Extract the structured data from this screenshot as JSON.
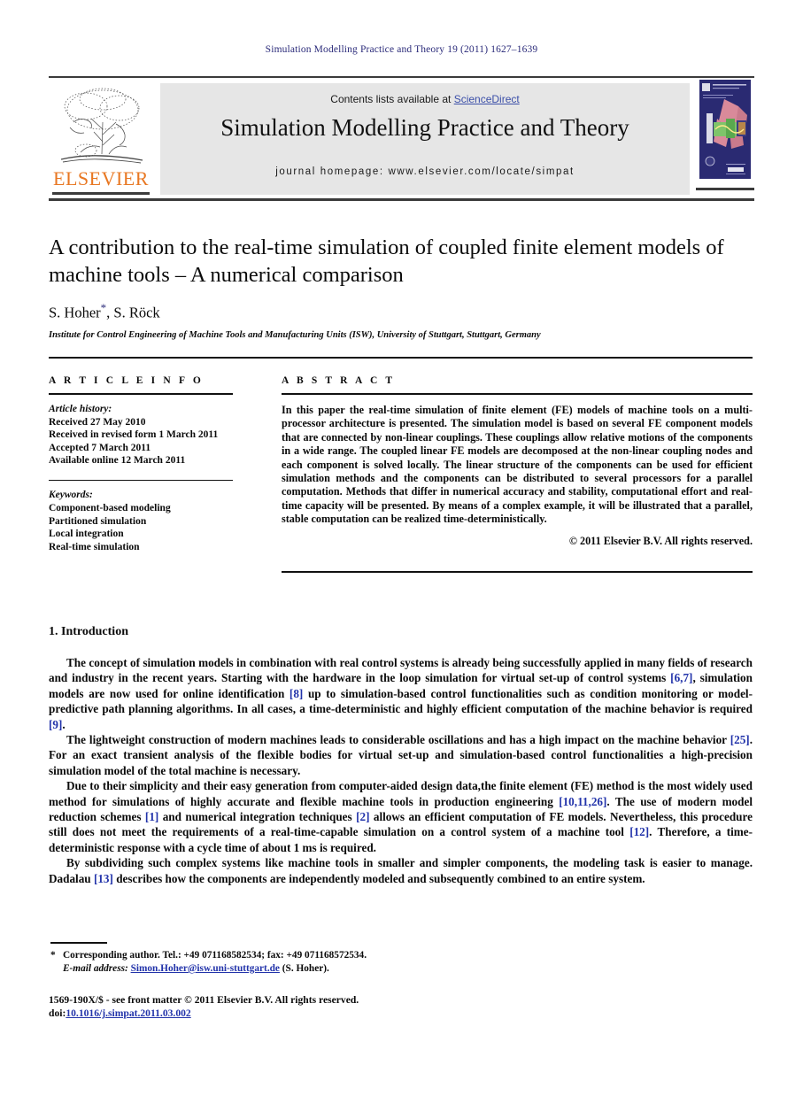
{
  "running_head": "Simulation Modelling Practice and Theory 19 (2011) 1627–1639",
  "masthead": {
    "contents_prefix": "Contents lists available at ",
    "sciencedirect": "ScienceDirect",
    "journal_title": "Simulation Modelling Practice and Theory",
    "homepage": "journal homepage: www.elsevier.com/locate/simpat",
    "publisher_wordmark": "ELSEVIER",
    "publisher_color": "#e87722",
    "link_color": "#3b4fa8",
    "banner_bg": "#e6e6e6",
    "cover_bg": "#2a2a72"
  },
  "title_block": {
    "title": "A contribution to the real-time simulation of coupled finite element models of machine tools – A numerical comparison",
    "authors": "S. Hoher",
    "authors_rest": ", S. Röck",
    "corresponding_marker": "*",
    "affiliation": "Institute for Control Engineering of Machine Tools and Manufacturing Units (ISW), University of Stuttgart, Stuttgart, Germany"
  },
  "article_info": {
    "label": "A R T I C L E   I N F O",
    "history_head": "Article history:",
    "history": [
      "Received 27 May 2010",
      "Received in revised form 1 March 2011",
      "Accepted 7 March 2011",
      "Available online 12 March 2011"
    ],
    "keywords_head": "Keywords:",
    "keywords": [
      "Component-based modeling",
      "Partitioned simulation",
      "Local integration",
      "Real-time simulation"
    ]
  },
  "abstract": {
    "label": "A B S T R A C T",
    "text": "In this paper the real-time simulation of finite element (FE) models of machine tools on a multi-processor architecture is presented. The simulation model is based on several FE component models that are connected by non-linear couplings. These couplings allow relative motions of the components in a wide range. The coupled linear FE models are decomposed at the non-linear coupling nodes and each component is solved locally. The linear structure of the components can be used for efficient simulation methods and the components can be distributed to several processors for a parallel computation. Methods that differ in numerical accuracy and stability, computational effort and real-time capacity will be presented. By means of a complex example, it will be illustrated that a parallel, stable computation can be realized time-deterministically.",
    "copyright": "© 2011 Elsevier B.V. All rights reserved."
  },
  "body": {
    "section_heading": "1. Introduction",
    "paragraphs": [
      {
        "parts": [
          {
            "t": "The concept of simulation models in combination with real control systems is already being successfully applied in many fields of research and industry in the recent years. Starting with the hardware in the loop simulation for virtual set-up of control systems "
          },
          {
            "t": "[6,7]",
            "ref": true
          },
          {
            "t": ", simulation models are now used for online identification "
          },
          {
            "t": "[8]",
            "ref": true
          },
          {
            "t": " up to simulation-based control functionalities such as condition monitoring or model-predictive path planning algorithms. In all cases, a time-deterministic and highly efficient computation of the machine behavior is required "
          },
          {
            "t": "[9]",
            "ref": true
          },
          {
            "t": "."
          }
        ]
      },
      {
        "parts": [
          {
            "t": "The lightweight construction of modern machines leads to considerable oscillations and has a high impact on the machine behavior "
          },
          {
            "t": "[25]",
            "ref": true
          },
          {
            "t": ". For an exact transient analysis of the flexible bodies for virtual set-up and simulation-based control functionalities a high-precision simulation model of the total machine is necessary."
          }
        ]
      },
      {
        "parts": [
          {
            "t": "Due to their simplicity and their easy generation from computer-aided design data,the finite element (FE) method is the most widely used method for simulations of highly accurate and flexible machine tools in production engineering "
          },
          {
            "t": "[10,11,26]",
            "ref": true
          },
          {
            "t": ". The use of modern model reduction schemes "
          },
          {
            "t": "[1]",
            "ref": true
          },
          {
            "t": " and numerical integration techniques "
          },
          {
            "t": "[2]",
            "ref": true
          },
          {
            "t": " allows an efficient computation of FE models. Nevertheless, this procedure still does not meet the requirements of a real-time-capable simulation on a control system of a machine tool "
          },
          {
            "t": "[12]",
            "ref": true
          },
          {
            "t": ". Therefore, a time-deterministic response with a cycle time of about 1 ms is required."
          }
        ]
      },
      {
        "parts": [
          {
            "t": "By subdividing such complex systems like machine tools in smaller and simpler components, the modeling task is easier to manage. Dadalau "
          },
          {
            "t": "[13]",
            "ref": true
          },
          {
            "t": " describes how the components are independently modeled and subsequently combined to an entire system."
          }
        ]
      }
    ]
  },
  "footnote": {
    "marker": "*",
    "line1": "Corresponding author. Tel.: +49 071168582534; fax: +49 071168572534.",
    "email_label": "E-mail address:",
    "email": "Simon.Hoher@isw.uni-stuttgart.de",
    "email_suffix": "(S. Hoher)."
  },
  "imprint": {
    "line1": "1569-190X/$ - see front matter © 2011 Elsevier B.V. All rights reserved.",
    "doi_prefix": "doi:",
    "doi": "10.1016/j.simpat.2011.03.002"
  }
}
